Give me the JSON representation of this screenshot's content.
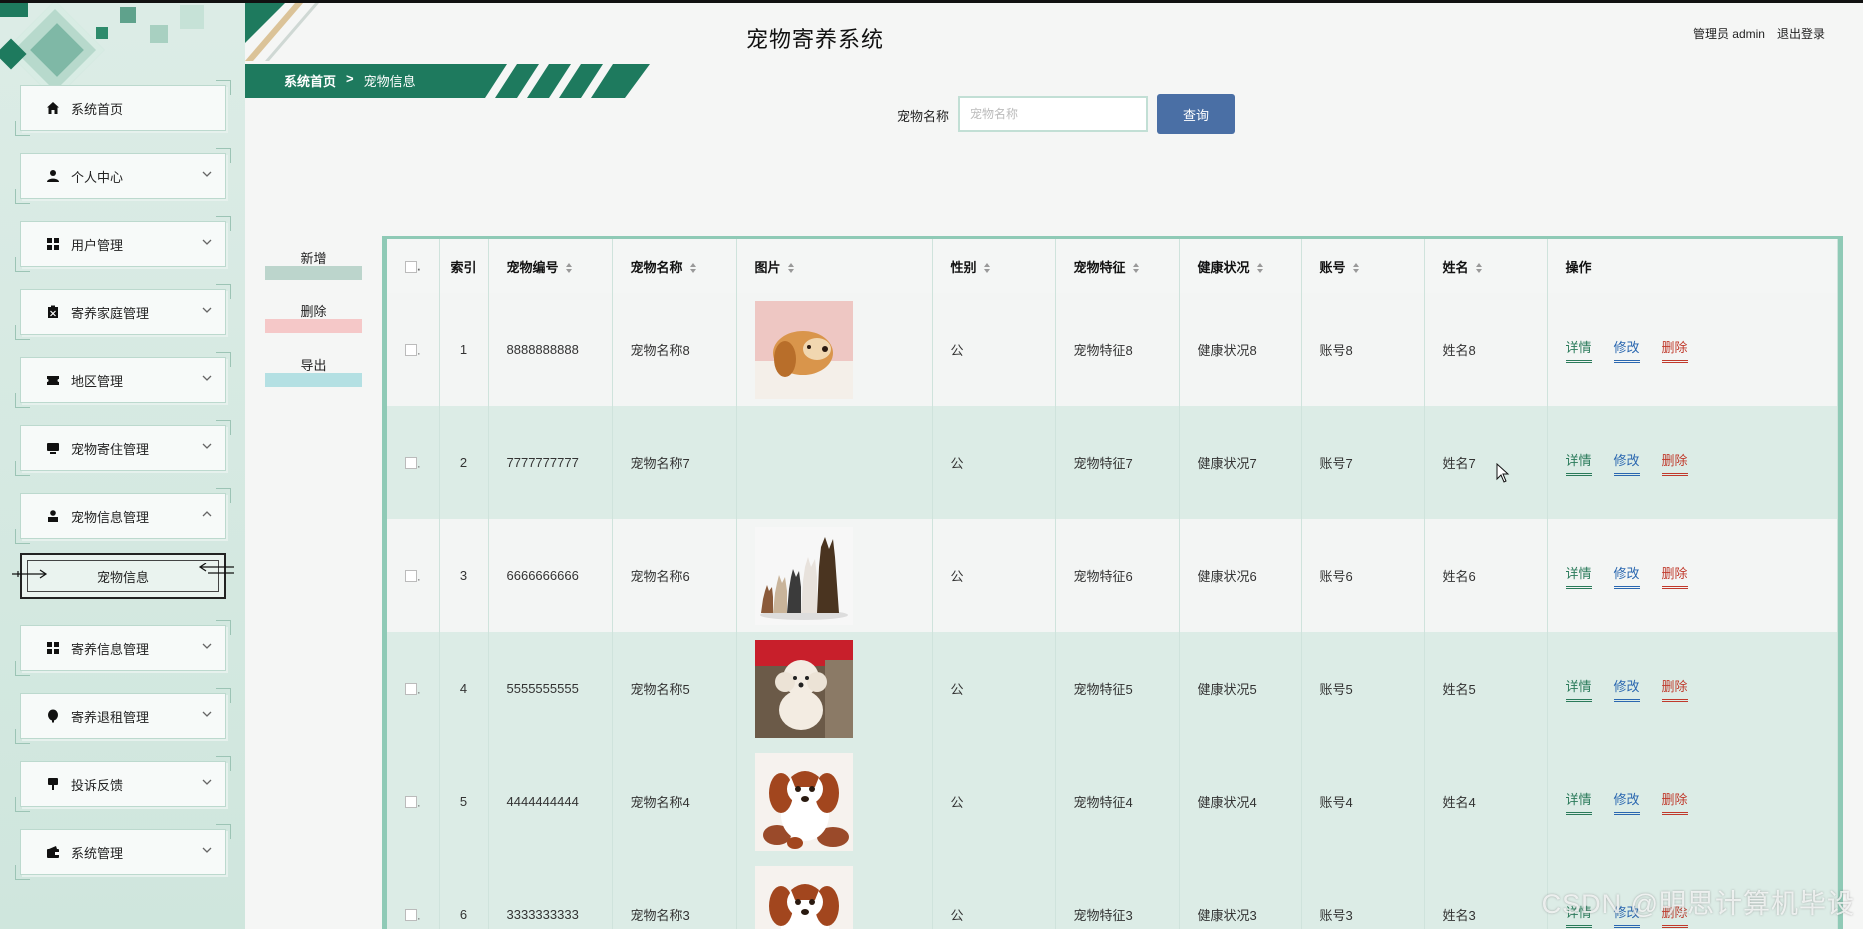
{
  "header": {
    "app_title": "宠物寄养系统",
    "user_label": "管理员 admin",
    "logout_label": "退出登录"
  },
  "breadcrumb": {
    "home": "系统首页",
    "separator": ">",
    "current": "宠物信息"
  },
  "sidebar": {
    "items": [
      {
        "label": "系统首页",
        "icon": "home-icon",
        "has_chevron": false
      },
      {
        "label": "个人中心",
        "icon": "person-icon",
        "has_chevron": true
      },
      {
        "label": "用户管理",
        "icon": "grid-icon",
        "has_chevron": true
      },
      {
        "label": "寄养家庭管理",
        "icon": "clipboard-icon",
        "has_chevron": true
      },
      {
        "label": "地区管理",
        "icon": "ticket-icon",
        "has_chevron": true
      },
      {
        "label": "宠物寄住管理",
        "icon": "monitor-icon",
        "has_chevron": true
      },
      {
        "label": "宠物信息管理",
        "icon": "user-badge-icon",
        "has_chevron": true,
        "expanded": true
      },
      {
        "label": "寄养信息管理",
        "icon": "grid-icon",
        "has_chevron": true
      },
      {
        "label": "寄养退租管理",
        "icon": "pin-icon",
        "has_chevron": true
      },
      {
        "label": "投诉反馈",
        "icon": "sign-icon",
        "has_chevron": true
      },
      {
        "label": "系统管理",
        "icon": "wallet-icon",
        "has_chevron": true
      }
    ],
    "submenu_active": "宠物信息"
  },
  "search": {
    "label": "宠物名称",
    "placeholder": "宠物名称",
    "value": "",
    "button_label": "查询"
  },
  "actions": {
    "add": "新增",
    "delete": "删除",
    "export": "导出"
  },
  "table": {
    "headers": {
      "index": "索引",
      "pet_no": "宠物编号",
      "pet_name": "宠物名称",
      "image": "图片",
      "gender": "性别",
      "feature": "宠物特征",
      "health": "健康状况",
      "account": "账号",
      "name": "姓名",
      "ops": "操作"
    },
    "ops": {
      "detail": "详情",
      "edit": "修改",
      "remove": "删除"
    },
    "rows": [
      {
        "index": "1",
        "pet_no": "8888888888",
        "pet_name": "宠物名称8",
        "image": "golden-puppy",
        "gender": "公",
        "feature": "宠物特征8",
        "health": "健康状况8",
        "account": "账号8",
        "name": "姓名8"
      },
      {
        "index": "2",
        "pet_no": "7777777777",
        "pet_name": "宠物名称7",
        "image": "",
        "gender": "公",
        "feature": "宠物特征7",
        "health": "健康状况7",
        "account": "账号7",
        "name": "姓名7"
      },
      {
        "index": "3",
        "pet_no": "6666666666",
        "pet_name": "宠物名称6",
        "image": "dogs-group",
        "gender": "公",
        "feature": "宠物特征6",
        "health": "健康状况6",
        "account": "账号6",
        "name": "姓名6"
      },
      {
        "index": "4",
        "pet_no": "5555555555",
        "pet_name": "宠物名称5",
        "image": "poodle",
        "gender": "公",
        "feature": "宠物特征5",
        "health": "健康状况5",
        "account": "账号5",
        "name": "姓名5"
      },
      {
        "index": "5",
        "pet_no": "4444444444",
        "pet_name": "宠物名称4",
        "image": "spaniel-puppy",
        "gender": "公",
        "feature": "宠物特征4",
        "health": "健康状况4",
        "account": "账号4",
        "name": "姓名4"
      },
      {
        "index": "6",
        "pet_no": "3333333333",
        "pet_name": "宠物名称3",
        "image": "spaniel-puppy",
        "gender": "公",
        "feature": "宠物特征3",
        "health": "健康状况3",
        "account": "账号3",
        "name": "姓名3"
      }
    ]
  },
  "watermark": "CSDN @明思计算机毕设",
  "colors": {
    "accent_green": "#1e7a5e",
    "search_button": "#4a6fa5",
    "row_alt": "#dcece6",
    "table_border": "#8fcab6",
    "detail": "#2a7a5a",
    "edit": "#2a67b0",
    "remove": "#c0392b"
  }
}
